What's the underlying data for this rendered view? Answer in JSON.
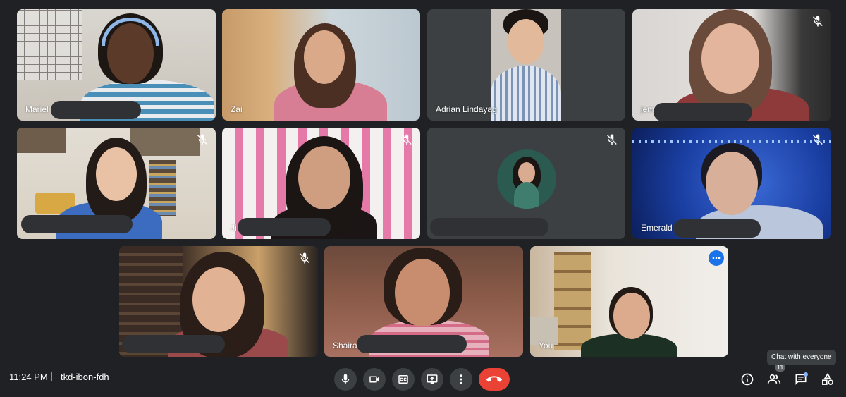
{
  "meeting": {
    "time": "11:24 PM",
    "code": "tkd-ibon-fdh",
    "tooltip": "Chat with everyone",
    "participant_count": "11"
  },
  "participants": [
    {
      "name": "Mariel",
      "muted": false
    },
    {
      "name": "Zai",
      "muted": false
    },
    {
      "name": "Adrian Lindayag",
      "muted": false
    },
    {
      "name": "jem",
      "muted": true
    },
    {
      "name": "",
      "muted": true
    },
    {
      "name": "Ji",
      "muted": true
    },
    {
      "name": "",
      "muted": true
    },
    {
      "name": "Emerald",
      "muted": true
    },
    {
      "name": "",
      "muted": true
    },
    {
      "name": "Shaira",
      "muted": false
    },
    {
      "name": "You",
      "muted": false
    }
  ],
  "controls": {
    "mic": "mic-icon",
    "camera": "camera-icon",
    "captions": "captions-icon",
    "present": "present-icon",
    "more": "more-options-icon",
    "end_call": "end-call-icon"
  },
  "colors": {
    "background": "#202124",
    "tile": "#3c4043",
    "end_call": "#ea4335",
    "accent": "#8ab4f8"
  }
}
